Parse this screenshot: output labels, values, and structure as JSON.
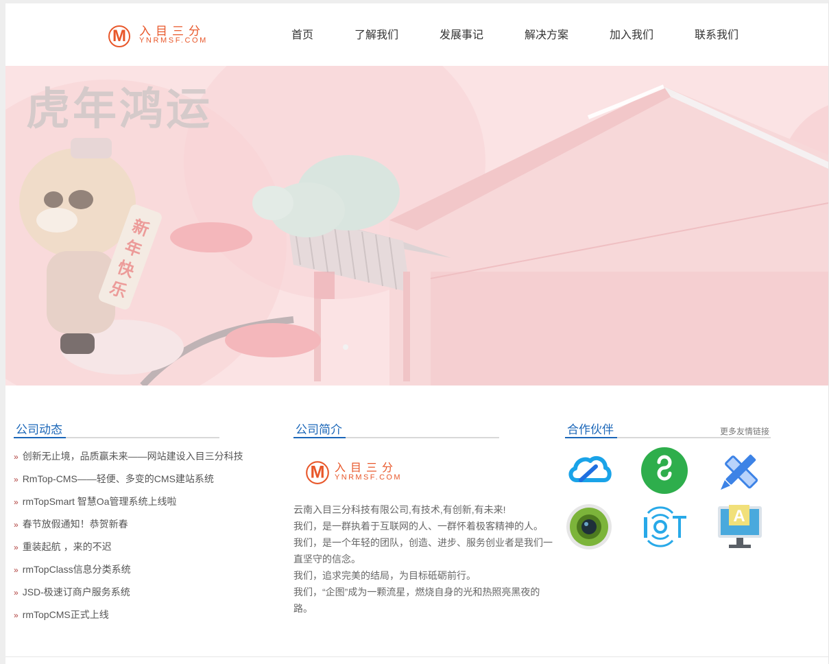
{
  "brand": {
    "name_cn": "入目三分",
    "domain": "YNRMSF.COM",
    "mark_letter": "M",
    "color": "#e8572a"
  },
  "nav": {
    "items": [
      {
        "label": "首页"
      },
      {
        "label": "了解我们"
      },
      {
        "label": "发展事记"
      },
      {
        "label": "解决方案"
      },
      {
        "label": "加入我们"
      },
      {
        "label": "联系我们"
      }
    ]
  },
  "banner": {
    "headline": "虎年鸿运",
    "scroll_text": "新年快乐",
    "background": "#fbe3e4"
  },
  "news": {
    "title": "公司动态",
    "items": [
      "创新无止境，品质赢未来——网站建设入目三分科技",
      "RmTop-CMS——轻便、多变的CMS建站系统",
      "rmTopSmart 智慧Oa管理系统上线啦",
      "春节放假通知！恭贺新春",
      "重装起航 ，来的不迟",
      "rmTopClass信息分类系统",
      "JSD-极速订商户服务系统",
      "rmTopCMS正式上线"
    ]
  },
  "about": {
    "title": "公司简介",
    "paragraphs": [
      "云南入目三分科技有限公司,有技术,有创新,有未来!",
      "我们，是一群执着于互联网的人、一群怀着极客精神的人。",
      "我们，是一个年轻的团队，创造、进步、服务创业者是我们一直坚守的信念。",
      "我们，追求完美的结局，为目标砥砺前行。",
      "我们，“企图”成为一颗流星，燃烧自身的光和热照亮黑夜的路。"
    ]
  },
  "partners": {
    "title": "合作伙伴",
    "more_label": "更多友情链接",
    "items": [
      {
        "icon": "tencent-cloud-icon"
      },
      {
        "icon": "mini-program-icon"
      },
      {
        "icon": "pencil-ruler-icon"
      },
      {
        "icon": "camera-lens-icon"
      },
      {
        "icon": "iot-icon"
      },
      {
        "icon": "monitor-design-icon",
        "letter": "A"
      }
    ]
  },
  "colors": {
    "accent_blue": "#1a66b8",
    "bullet_red": "#b0413e"
  }
}
